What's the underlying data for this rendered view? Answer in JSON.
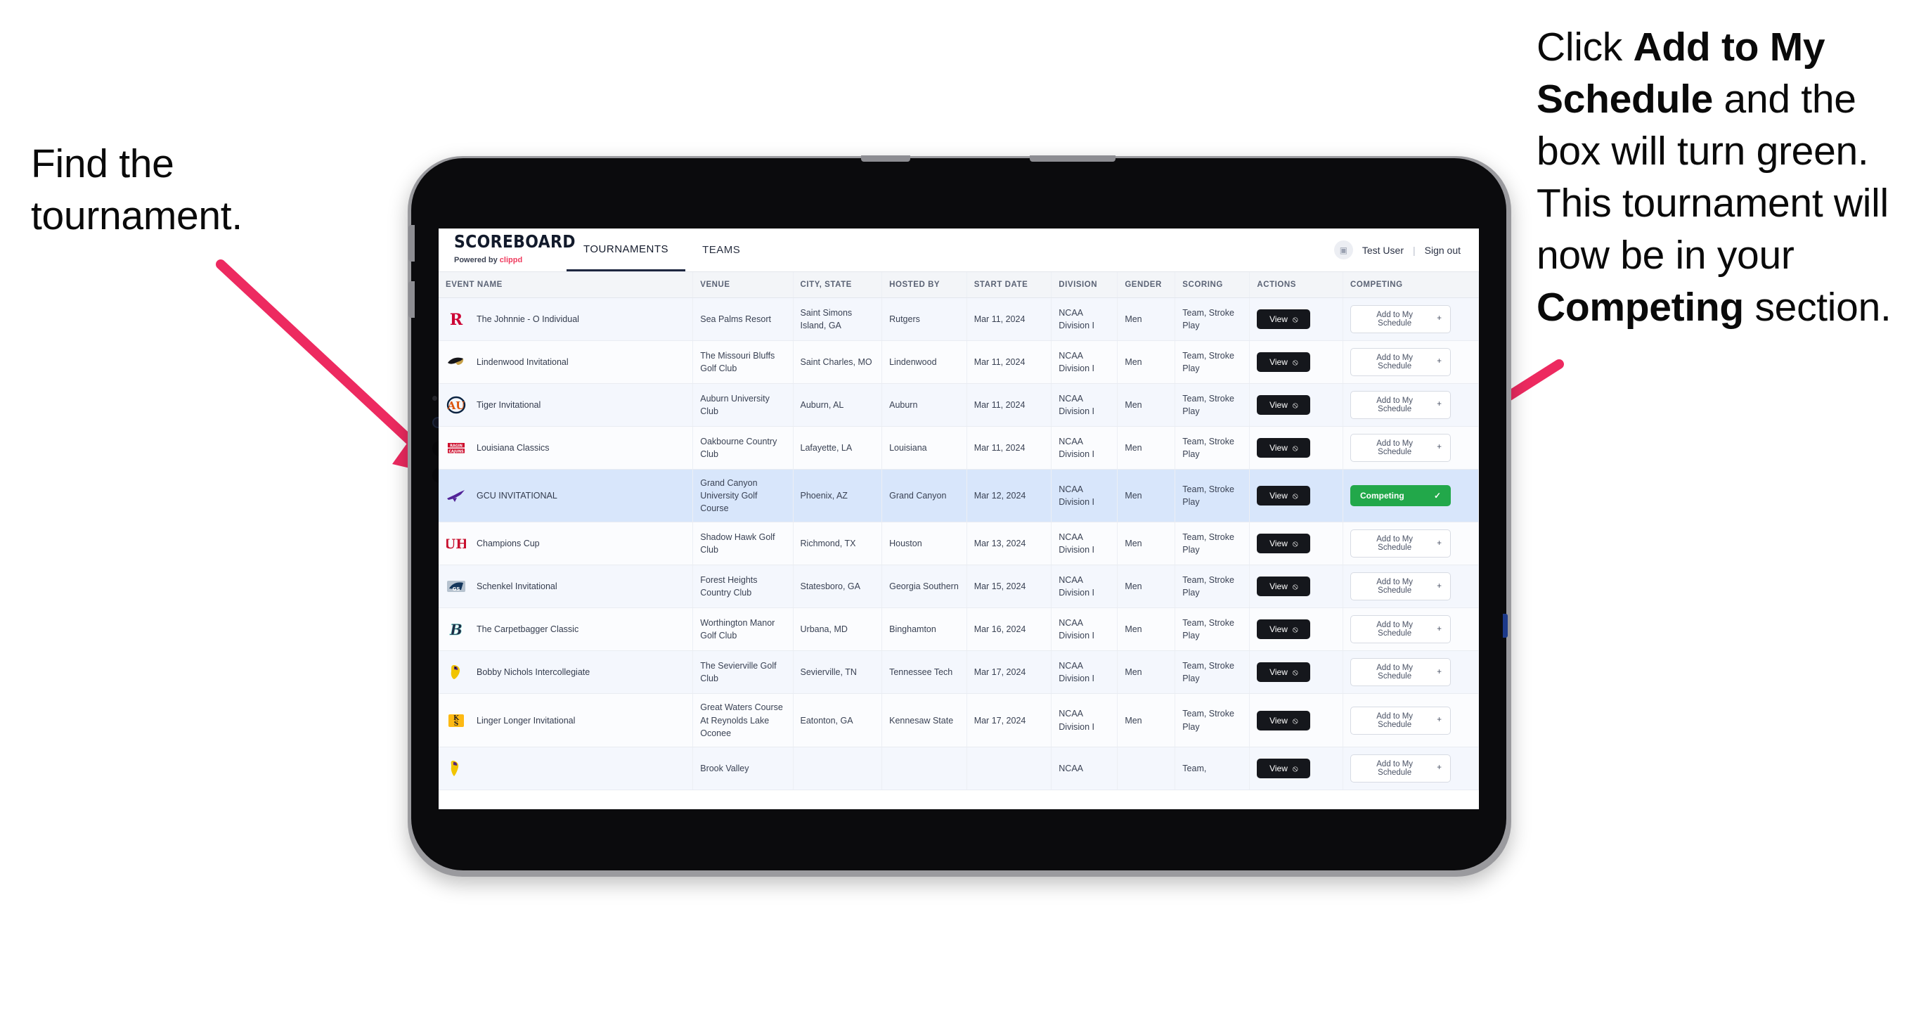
{
  "annotations": {
    "left": {
      "lines": [
        "Find the",
        "tournament."
      ]
    },
    "right": {
      "segments": [
        {
          "text": "Click ",
          "bold": false
        },
        {
          "text": "Add to My Schedule",
          "bold": true
        },
        {
          "text": " and the box will turn green. This tournament will now be in your ",
          "bold": false
        },
        {
          "text": "Competing",
          "bold": true
        },
        {
          "text": " section.",
          "bold": false
        }
      ]
    },
    "arrow_color": "#ED2A60"
  },
  "app": {
    "brand": {
      "name": "SCOREBOARD",
      "powered_prefix": "Powered by ",
      "powered_brand": "clippd"
    },
    "nav": [
      {
        "label": "TOURNAMENTS",
        "active": true
      },
      {
        "label": "TEAMS",
        "active": false
      }
    ],
    "header_right": {
      "avatar_icon": "user-avatar-icon",
      "user": "Test User",
      "separator": "|",
      "sign_out": "Sign out"
    },
    "table": {
      "columns": [
        "EVENT NAME",
        "VENUE",
        "CITY, STATE",
        "HOSTED BY",
        "START DATE",
        "DIVISION",
        "GENDER",
        "SCORING",
        "ACTIONS",
        "COMPETING"
      ],
      "view_label": "View",
      "add_label": "Add to My Schedule",
      "competing_label": "Competing",
      "rows": [
        {
          "logo": "rutgers-logo",
          "event": "The Johnnie - O Individual",
          "venue": "Sea Palms Resort",
          "city": "Saint Simons Island, GA",
          "host": "Rutgers",
          "date": "Mar 11, 2024",
          "division": "NCAA Division I",
          "gender": "Men",
          "scoring": "Team, Stroke Play",
          "competing": false
        },
        {
          "logo": "lindenwood-logo",
          "event": "Lindenwood Invitational",
          "venue": "The Missouri Bluffs Golf Club",
          "city": "Saint Charles, MO",
          "host": "Lindenwood",
          "date": "Mar 11, 2024",
          "division": "NCAA Division I",
          "gender": "Men",
          "scoring": "Team, Stroke Play",
          "competing": false
        },
        {
          "logo": "auburn-logo",
          "event": "Tiger Invitational",
          "venue": "Auburn University Club",
          "city": "Auburn, AL",
          "host": "Auburn",
          "date": "Mar 11, 2024",
          "division": "NCAA Division I",
          "gender": "Men",
          "scoring": "Team, Stroke Play",
          "competing": false
        },
        {
          "logo": "louisiana-logo",
          "event": "Louisiana Classics",
          "venue": "Oakbourne Country Club",
          "city": "Lafayette, LA",
          "host": "Louisiana",
          "date": "Mar 11, 2024",
          "division": "NCAA Division I",
          "gender": "Men",
          "scoring": "Team, Stroke Play",
          "competing": false
        },
        {
          "logo": "gcu-logo",
          "event": "GCU INVITATIONAL",
          "venue": "Grand Canyon University Golf Course",
          "city": "Phoenix, AZ",
          "host": "Grand Canyon",
          "date": "Mar 12, 2024",
          "division": "NCAA Division I",
          "gender": "Men",
          "scoring": "Team, Stroke Play",
          "competing": true
        },
        {
          "logo": "houston-logo",
          "event": "Champions Cup",
          "venue": "Shadow Hawk Golf Club",
          "city": "Richmond, TX",
          "host": "Houston",
          "date": "Mar 13, 2024",
          "division": "NCAA Division I",
          "gender": "Men",
          "scoring": "Team, Stroke Play",
          "competing": false
        },
        {
          "logo": "georgia-southern-logo",
          "event": "Schenkel Invitational",
          "venue": "Forest Heights Country Club",
          "city": "Statesboro, GA",
          "host": "Georgia Southern",
          "date": "Mar 15, 2024",
          "division": "NCAA Division I",
          "gender": "Men",
          "scoring": "Team, Stroke Play",
          "competing": false
        },
        {
          "logo": "binghamton-logo",
          "event": "The Carpetbagger Classic",
          "venue": "Worthington Manor Golf Club",
          "city": "Urbana, MD",
          "host": "Binghamton",
          "date": "Mar 16, 2024",
          "division": "NCAA Division I",
          "gender": "Men",
          "scoring": "Team, Stroke Play",
          "competing": false
        },
        {
          "logo": "tennessee-tech-logo",
          "event": "Bobby Nichols Intercollegiate",
          "venue": "The Sevierville Golf Club",
          "city": "Sevierville, TN",
          "host": "Tennessee Tech",
          "date": "Mar 17, 2024",
          "division": "NCAA Division I",
          "gender": "Men",
          "scoring": "Team, Stroke Play",
          "competing": false
        },
        {
          "logo": "kennesaw-state-logo",
          "event": "Linger Longer Invitational",
          "venue": "Great Waters Course At Reynolds Lake Oconee",
          "city": "Eatonton, GA",
          "host": "Kennesaw State",
          "date": "Mar 17, 2024",
          "division": "NCAA Division I",
          "gender": "Men",
          "scoring": "Team, Stroke Play",
          "competing": false
        },
        {
          "logo": "partial-logo",
          "event": "",
          "venue": "Brook Valley",
          "city": "",
          "host": "",
          "date": "",
          "division": "NCAA",
          "gender": "",
          "scoring": "Team,",
          "competing": false
        }
      ]
    }
  },
  "colors": {
    "accent_green": "#22a84a",
    "accent_pink": "#ED2A60",
    "brand_red": "#ef3a5d",
    "row_selected": "#d8e6fb"
  }
}
